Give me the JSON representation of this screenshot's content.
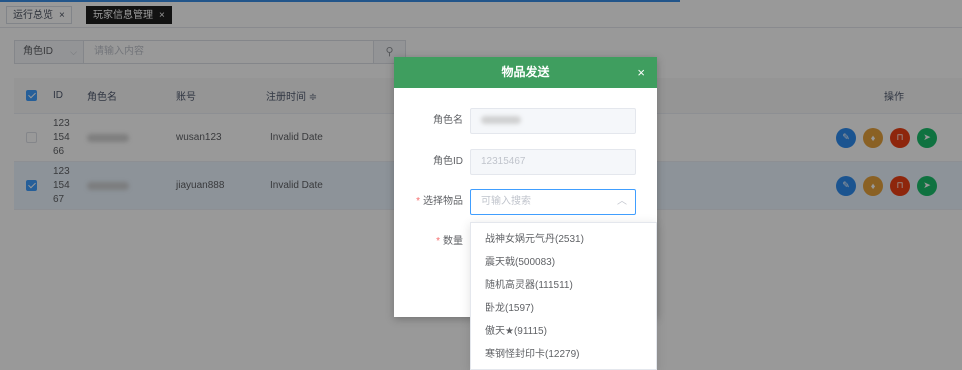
{
  "tabs": [
    {
      "label": "运行总览",
      "close": "×",
      "active": false
    },
    {
      "label": "玩家信息管理",
      "close": "×",
      "active": true
    }
  ],
  "search": {
    "field_select": "角色ID",
    "placeholder": "请输入内容"
  },
  "table": {
    "headers": {
      "id": "ID",
      "role_name": "角色名",
      "account": "账号",
      "reg_time": "注册时间 ≑",
      "actions": "操作"
    },
    "rows": [
      {
        "checked": false,
        "id_lines": [
          "123",
          "154",
          "66"
        ],
        "account": "wusan123",
        "reg_time": "Invalid Date"
      },
      {
        "checked": true,
        "id_lines": [
          "123",
          "154",
          "67"
        ],
        "account": "jiayuan888",
        "reg_time": "Invalid Date"
      }
    ]
  },
  "colors": {
    "dialog_header": "#3f9e5f",
    "op_edit": "#2d8cf0",
    "op_gift": "#e6a23c",
    "op_lock": "#ed4014",
    "op_send": "#19be6b"
  },
  "dialog": {
    "title": "物品发送",
    "close": "×",
    "fields": {
      "role_name_label": "角色名",
      "role_id_label": "角色ID",
      "role_id_value": "12315467",
      "item_label": "选择物品",
      "item_placeholder": "可输入搜索",
      "qty_label": "数量"
    }
  },
  "dropdown": {
    "options": [
      "战神女娲元气丹(2531)",
      "震天戟(500083)",
      "随机高灵器(111511)",
      "卧龙(1597)",
      "傲天★(91115)",
      "寒钢怪封印卡(12279)"
    ]
  }
}
